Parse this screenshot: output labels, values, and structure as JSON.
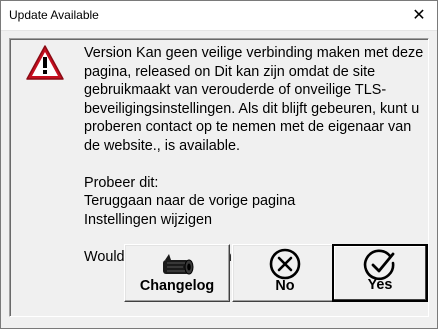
{
  "window": {
    "title": "Update Available"
  },
  "dialog": {
    "message": "Version Kan geen veilige verbinding maken met deze pagina, released on Dit kan zijn omdat de site gebruikmaakt van verouderde of onveilige TLS-beveiligingsinstellingen. Als dit blijft gebeuren, kunt u proberen contact op te nemen met de eigenaar van de website., is available.\n\nProbeer dit:\nTeruggaan naar de vorige pagina\nInstellingen wijzigen\n\nWould you like to download and install it?",
    "icon": "warning-icon"
  },
  "buttons": {
    "changelog": {
      "label": "Changelog",
      "icon": "log-icon"
    },
    "no": {
      "label": "No",
      "icon": "circle-x-icon"
    },
    "yes": {
      "label": "Yes",
      "icon": "circle-check-icon"
    }
  },
  "colors": {
    "warning_red": "#c50f1f",
    "dialog_bg": "#f0f0f0",
    "titlebar_bg": "#ffffff"
  }
}
